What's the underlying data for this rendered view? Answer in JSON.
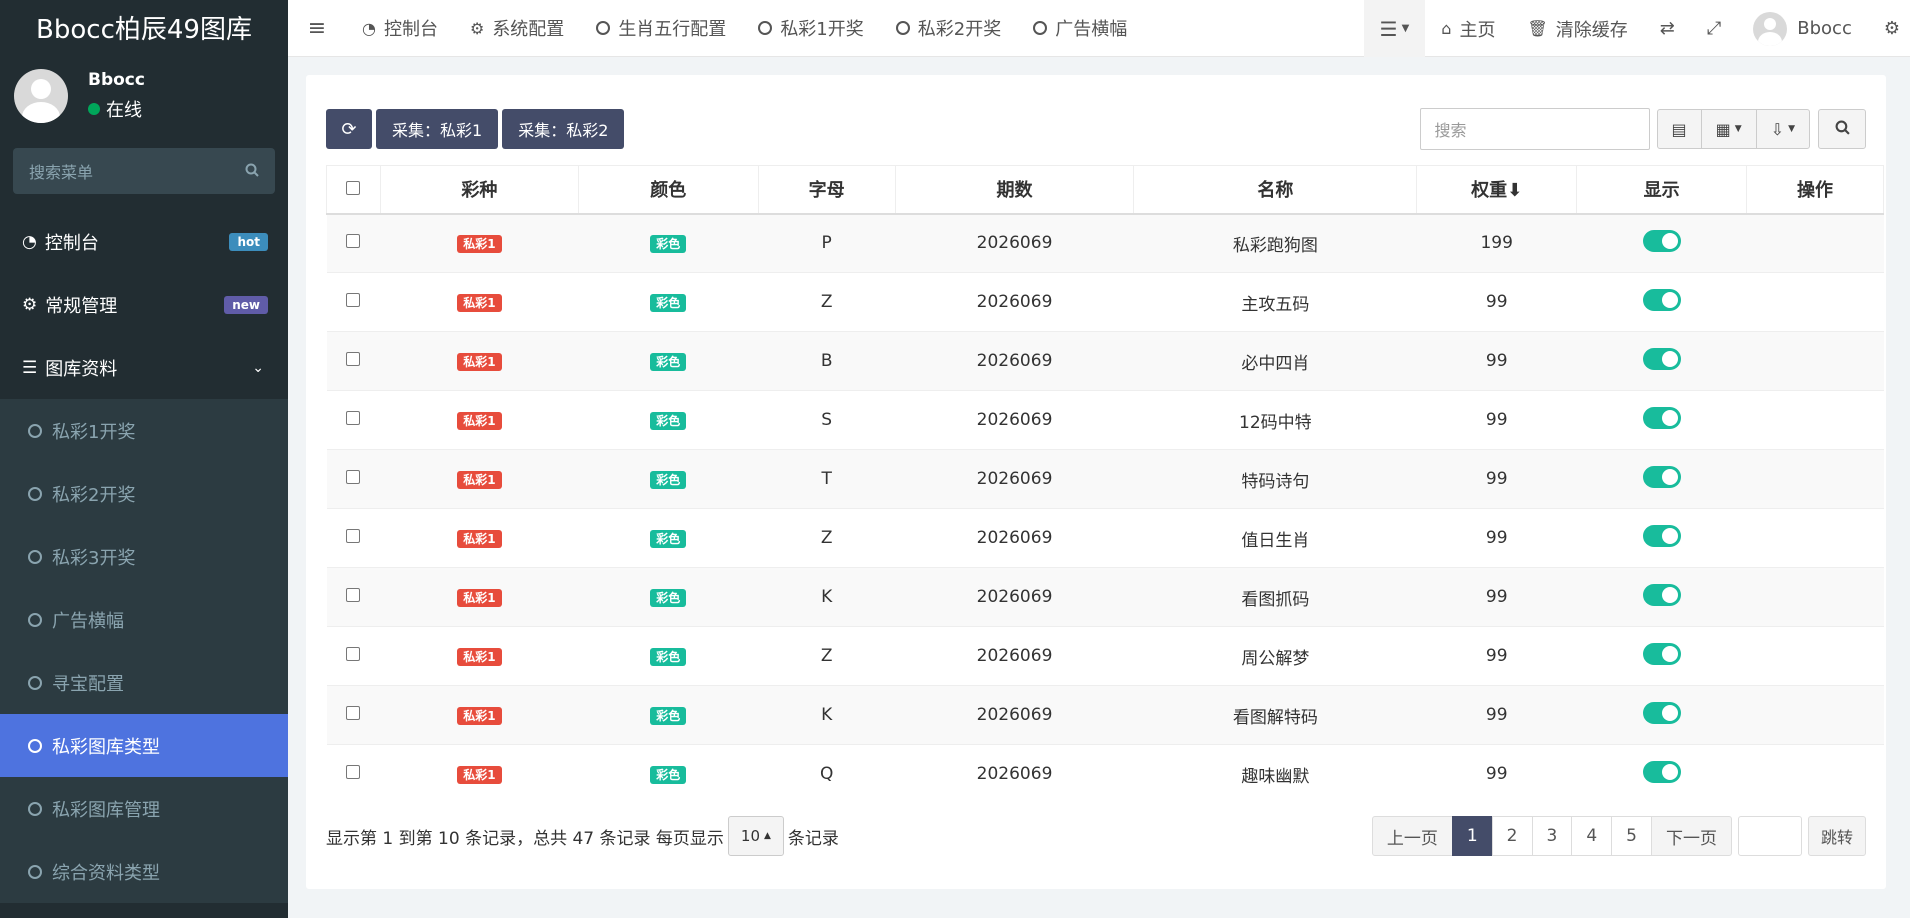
{
  "app": {
    "title": "Bbocc柏辰49图库"
  },
  "sidebar": {
    "user_name": "Bbocc",
    "user_status": "在线",
    "search_placeholder": "搜索菜单",
    "menu": [
      {
        "label": "控制台",
        "badge": "hot"
      },
      {
        "label": "常规管理",
        "badge": "new"
      },
      {
        "label": "图库资料"
      }
    ],
    "submenu": [
      {
        "label": "私彩1开奖"
      },
      {
        "label": "私彩2开奖"
      },
      {
        "label": "私彩3开奖"
      },
      {
        "label": "广告横幅"
      },
      {
        "label": "寻宝配置"
      },
      {
        "label": "私彩图库类型",
        "active": true
      },
      {
        "label": "私彩图库管理"
      },
      {
        "label": "综合资料类型"
      }
    ]
  },
  "topnav": {
    "tabs": [
      "控制台",
      "系统配置",
      "生肖五行配置",
      "私彩1开奖",
      "私彩2开奖",
      "广告横幅"
    ],
    "home": "主页",
    "clear_cache": "清除缓存",
    "user": "Bbocc"
  },
  "toolbar": {
    "collect1": "采集：私彩1",
    "collect2": "采集：私彩2",
    "search_placeholder": "搜索"
  },
  "table": {
    "headers": [
      "彩种",
      "颜色",
      "字母",
      "期数",
      "名称",
      "权重⬇",
      "显示",
      "操作"
    ],
    "rows": [
      {
        "type": "私彩1",
        "color": "彩色",
        "letter": "P",
        "issue": "2026069",
        "name": "私彩跑狗图",
        "weight": "199"
      },
      {
        "type": "私彩1",
        "color": "彩色",
        "letter": "Z",
        "issue": "2026069",
        "name": "主攻五码",
        "weight": "99"
      },
      {
        "type": "私彩1",
        "color": "彩色",
        "letter": "B",
        "issue": "2026069",
        "name": "必中四肖",
        "weight": "99"
      },
      {
        "type": "私彩1",
        "color": "彩色",
        "letter": "S",
        "issue": "2026069",
        "name": "12码中特",
        "weight": "99"
      },
      {
        "type": "私彩1",
        "color": "彩色",
        "letter": "T",
        "issue": "2026069",
        "name": "特码诗句",
        "weight": "99"
      },
      {
        "type": "私彩1",
        "color": "彩色",
        "letter": "Z",
        "issue": "2026069",
        "name": "值日生肖",
        "weight": "99"
      },
      {
        "type": "私彩1",
        "color": "彩色",
        "letter": "K",
        "issue": "2026069",
        "name": "看图抓码",
        "weight": "99"
      },
      {
        "type": "私彩1",
        "color": "彩色",
        "letter": "Z",
        "issue": "2026069",
        "name": "周公解梦",
        "weight": "99"
      },
      {
        "type": "私彩1",
        "color": "彩色",
        "letter": "K",
        "issue": "2026069",
        "name": "看图解特码",
        "weight": "99"
      },
      {
        "type": "私彩1",
        "color": "彩色",
        "letter": "Q",
        "issue": "2026069",
        "name": "趣味幽默",
        "weight": "99"
      }
    ]
  },
  "footer": {
    "info": "显示第 1 到第 10 条记录，总共 47 条记录 每页显示",
    "page_size": "10",
    "records_suffix": "条记录",
    "prev": "上一页",
    "next": "下一页",
    "pages": [
      "1",
      "2",
      "3",
      "4",
      "5"
    ],
    "current_page": "1",
    "jump": "跳转"
  },
  "colors": {
    "sidebar_bg": "#222d32",
    "active_item": "#4e73df",
    "primary_button": "#444c69",
    "label_red": "#e74c3c",
    "label_teal": "#18bc9c"
  }
}
